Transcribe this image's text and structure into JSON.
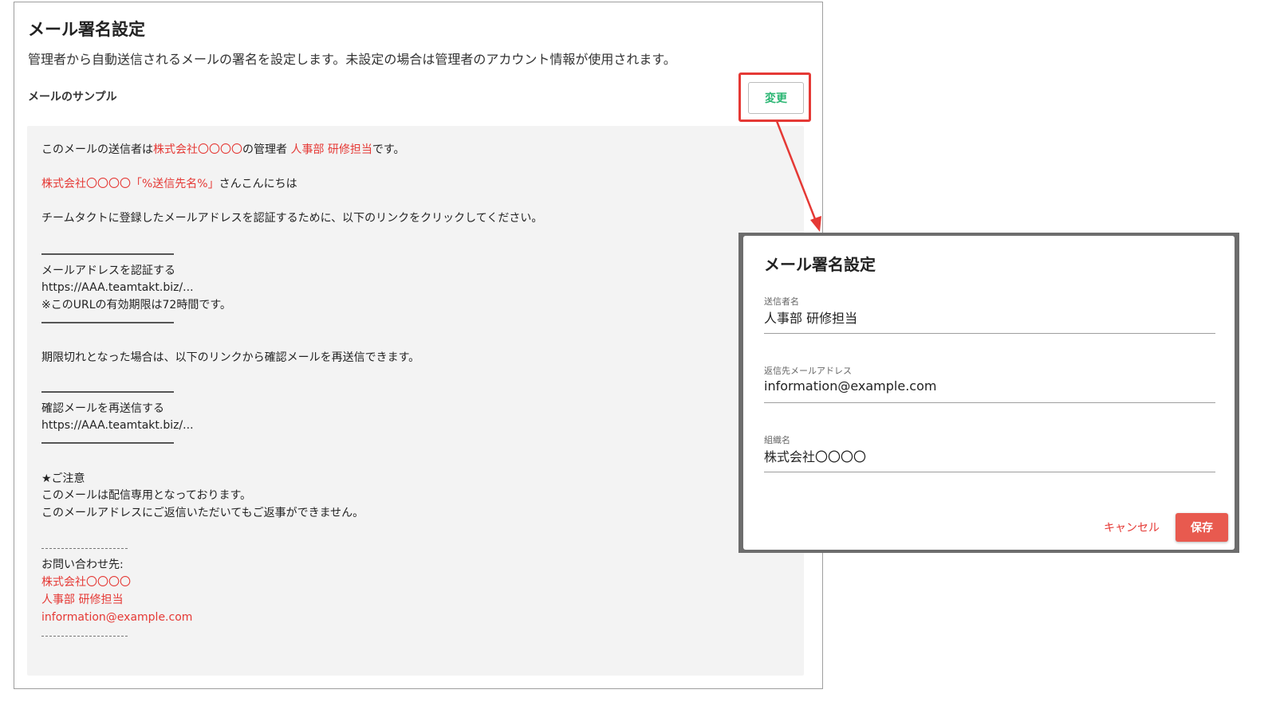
{
  "page": {
    "title": "メール署名設定",
    "description": "管理者から自動送信されるメールの署名を設定します。未設定の場合は管理者のアカウント情報が使用されます。",
    "sample_label": "メールのサンプル",
    "change_button": "変更"
  },
  "sample": {
    "l1_a": "このメールの送信者は",
    "l1_org": "株式会社〇〇〇〇",
    "l1_b": "の管理者 ",
    "l1_sender": "人事部 研修担当",
    "l1_c": "です。",
    "l2_org": "株式会社〇〇〇〇",
    "l2_placeholder": "「%送信先名%」",
    "l2_b": "さんこんにちは",
    "l3": "チームタクトに登録したメールアドレスを認証するために、以下のリンクをクリックしてください。",
    "verify_title": "メールアドレスを認証する",
    "verify_url": "https://AAA.teamtakt.biz/...",
    "verify_note": "※このURLの有効期限は72時間です。",
    "expired": "期限切れとなった場合は、以下のリンクから確認メールを再送信できます。",
    "resend_title": "確認メールを再送信する",
    "resend_url": "https://AAA.teamtakt.biz/...",
    "notice_title": "★ご注意",
    "notice_1": "このメールは配信専用となっております。",
    "notice_2": "このメールアドレスにご返信いただいてもご返事ができません。",
    "contact_label": "お問い合わせ先:",
    "contact_org": "株式会社〇〇〇〇",
    "contact_sender": "人事部 研修担当",
    "contact_email": "information@example.com"
  },
  "dialog": {
    "title": "メール署名設定",
    "sender_label": "送信者名",
    "sender_value": "人事部 研修担当",
    "reply_label": "返信先メールアドレス",
    "reply_value": "information@example.com",
    "org_label": "組織名",
    "org_value": "株式会社〇〇〇〇",
    "cancel": "キャンセル",
    "save": "保存"
  },
  "colors": {
    "accent_red": "#e53935",
    "change_green": "#2bb673",
    "save_button": "#e85a4f",
    "sample_bg": "#f3f3f3"
  }
}
